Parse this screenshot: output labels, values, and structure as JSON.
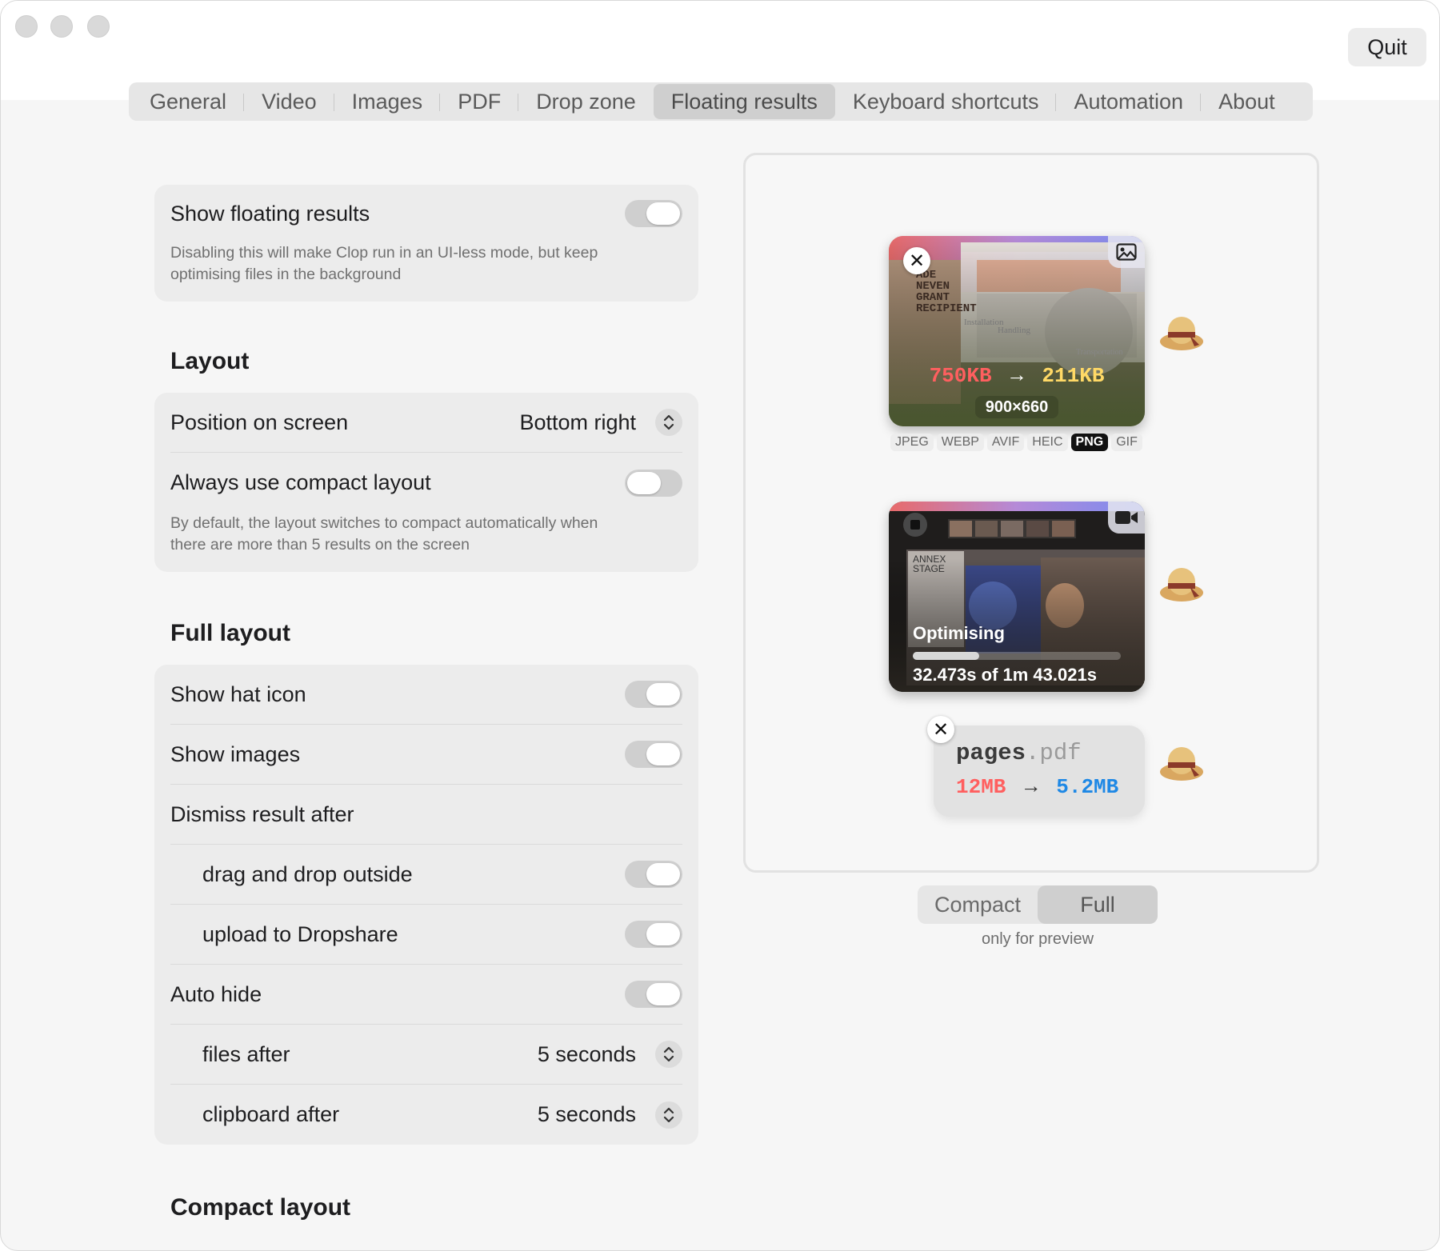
{
  "window": {
    "quit_label": "Quit"
  },
  "tabs": [
    {
      "label": "General"
    },
    {
      "label": "Video"
    },
    {
      "label": "Images"
    },
    {
      "label": "PDF"
    },
    {
      "label": "Drop zone"
    },
    {
      "label": "Floating results",
      "active": true
    },
    {
      "label": "Keyboard shortcuts"
    },
    {
      "label": "Automation"
    },
    {
      "label": "About"
    }
  ],
  "settings": {
    "show_floating": {
      "label": "Show floating results",
      "enabled": true,
      "description": "Disabling this will make Clop run in an UI-less mode, but keep optimising files in the background"
    },
    "layout": {
      "title": "Layout",
      "position_label": "Position on screen",
      "position_value": "Bottom right",
      "compact_label": "Always use compact layout",
      "compact_enabled": false,
      "compact_description": "By default, the layout switches to compact automatically when there are more than 5 results on the screen"
    },
    "full_layout": {
      "title": "Full layout",
      "show_hat_icon": "Show hat icon",
      "show_images": "Show images",
      "dismiss_after": "Dismiss result after",
      "drag_drop_outside": "drag and drop outside",
      "upload_dropshare": "upload to Dropshare",
      "auto_hide": "Auto hide",
      "files_after_label": "files after",
      "files_after_value": "5 seconds",
      "clipboard_after_label": "clipboard after",
      "clipboard_after_value": "5 seconds"
    },
    "compact_layout": {
      "title": "Compact layout"
    }
  },
  "preview": {
    "image_result": {
      "old_size": "750KB",
      "arrow": "→",
      "new_size": "211KB",
      "dimensions": "900×660",
      "formats": [
        "JPEG",
        "WEBP",
        "AVIF",
        "HEIC",
        "PNG",
        "GIF"
      ],
      "selected_format": "PNG",
      "thumbnail_text_1": "ADE NEVEN GRANT RECIPIENT",
      "thumbnail_text_2": "Installation",
      "thumbnail_text_3": "Handling",
      "thumbnail_text_4": "Transportation"
    },
    "video_result": {
      "status": "Optimising",
      "progress": 0.32,
      "progress_text": "32.473s of 1m 43.021s",
      "thumbnail_text": "ANNEX STAGE"
    },
    "pdf_result": {
      "name": "pages",
      "extension": ".pdf",
      "old_size": "12MB",
      "arrow": "→",
      "new_size": "5.2MB"
    },
    "mode_options": [
      "Compact",
      "Full"
    ],
    "active_mode": "Full",
    "note": "only for preview"
  },
  "colors": {
    "old_size": "#ff5f5f",
    "new_size_image": "#ffd966",
    "new_size_pdf": "#1e88e5",
    "window_bg": "#f6f6f6"
  }
}
